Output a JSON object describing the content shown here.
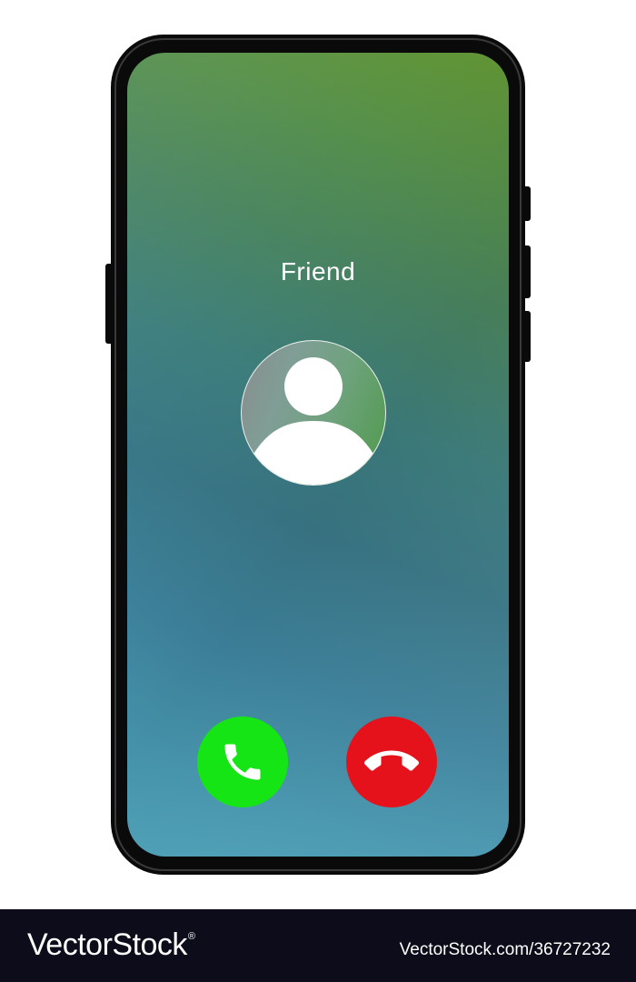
{
  "call": {
    "caller_name": "Friend",
    "accept_icon": "phone-handset-icon",
    "decline_icon": "phone-hangup-icon"
  },
  "colors": {
    "accept": "#15e515",
    "decline": "#e5121b",
    "screen_gradient_top": "#639634",
    "screen_gradient_bottom": "#52a8c0",
    "phone_body": "#0a0a0a"
  },
  "watermark": {
    "brand": "VectorStock",
    "registered_mark": "®",
    "url": "VectorStock.com/36727232"
  }
}
